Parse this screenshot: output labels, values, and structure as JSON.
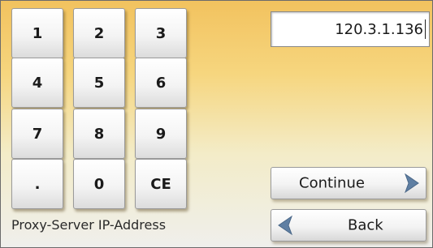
{
  "keypad": {
    "keys": [
      "1",
      "2",
      "3",
      "4",
      "5",
      "6",
      "7",
      "8",
      "9",
      ".",
      "0",
      "CE"
    ]
  },
  "ip_field": {
    "value": "120.3.1.136"
  },
  "buttons": {
    "continue_label": "Continue",
    "back_label": "Back"
  },
  "caption": "Proxy-Server IP-Address",
  "icons": {
    "continue": "chevron-right-icon",
    "back": "chevron-left-icon"
  },
  "colors": {
    "arrow": "#5f7fa3",
    "background_top": "#f2c25e",
    "background_bottom": "#efefec"
  }
}
